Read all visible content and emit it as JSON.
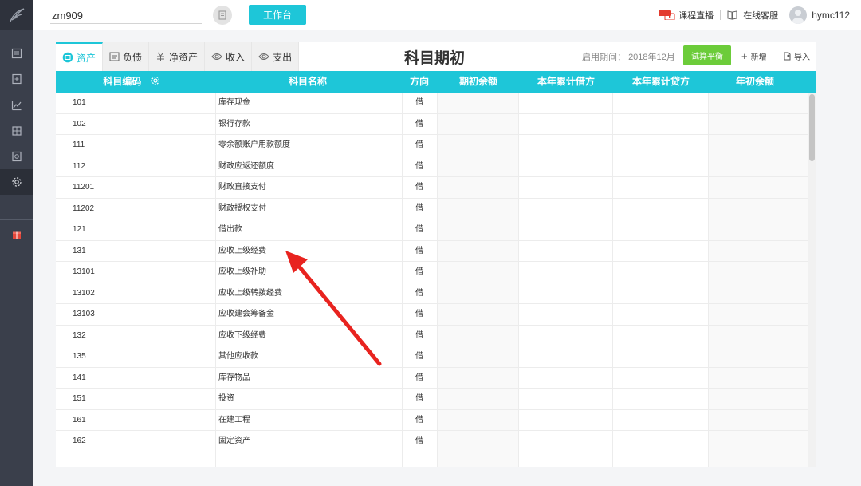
{
  "topbar": {
    "company": "zm909",
    "workbench_label": "工作台",
    "new_badge": "NEW",
    "live_label": "课程直播",
    "service_label": "在线客服",
    "username": "hymc112"
  },
  "tabs": [
    {
      "label": "资产",
      "icon": "asset-icon",
      "active": true
    },
    {
      "label": "负债",
      "icon": "liability-icon",
      "active": false
    },
    {
      "label": "净资产",
      "icon": "net-asset-icon",
      "active": false
    },
    {
      "label": "收入",
      "icon": "income-icon",
      "active": false
    },
    {
      "label": "支出",
      "icon": "expense-icon",
      "active": false
    }
  ],
  "page": {
    "title": "科目期初",
    "period_label": "启用期间：",
    "period_value": "2018年12月",
    "trial_balance_label": "试算平衡",
    "add_label": "新增",
    "import_label": "导入"
  },
  "table": {
    "headers": {
      "code": "科目编码",
      "name": "科目名称",
      "direction": "方向",
      "opening": "期初余额",
      "ytd_debit": "本年累计借方",
      "ytd_credit": "本年累计贷方",
      "year_opening": "年初余额"
    },
    "rows": [
      {
        "code": "101",
        "name": "库存现金",
        "dir": "借"
      },
      {
        "code": "102",
        "name": "银行存款",
        "dir": "借"
      },
      {
        "code": "111",
        "name": "零余额账户用款额度",
        "dir": "借"
      },
      {
        "code": "112",
        "name": "财政应返还额度",
        "dir": "借"
      },
      {
        "code": "11201",
        "name": "财政直接支付",
        "dir": "借"
      },
      {
        "code": "11202",
        "name": "财政授权支付",
        "dir": "借"
      },
      {
        "code": "121",
        "name": "借出款",
        "dir": "借"
      },
      {
        "code": "131",
        "name": "应收上级经费",
        "dir": "借"
      },
      {
        "code": "13101",
        "name": "应收上级补助",
        "dir": "借"
      },
      {
        "code": "13102",
        "name": "应收上级转拨经费",
        "dir": "借"
      },
      {
        "code": "13103",
        "name": "应收建会筹备金",
        "dir": "借"
      },
      {
        "code": "132",
        "name": "应收下级经费",
        "dir": "借"
      },
      {
        "code": "135",
        "name": "其他应收款",
        "dir": "借"
      },
      {
        "code": "141",
        "name": "库存物品",
        "dir": "借"
      },
      {
        "code": "151",
        "name": "投资",
        "dir": "借"
      },
      {
        "code": "161",
        "name": "在建工程",
        "dir": "借"
      },
      {
        "code": "162",
        "name": "固定资产",
        "dir": "借"
      }
    ]
  },
  "colors": {
    "accent": "#1ec6d8",
    "trial_button": "#6ccc3a",
    "sidebar": "#3a3f4b",
    "annotation_arrow": "#e8231f",
    "badge": "#e33b2e"
  }
}
